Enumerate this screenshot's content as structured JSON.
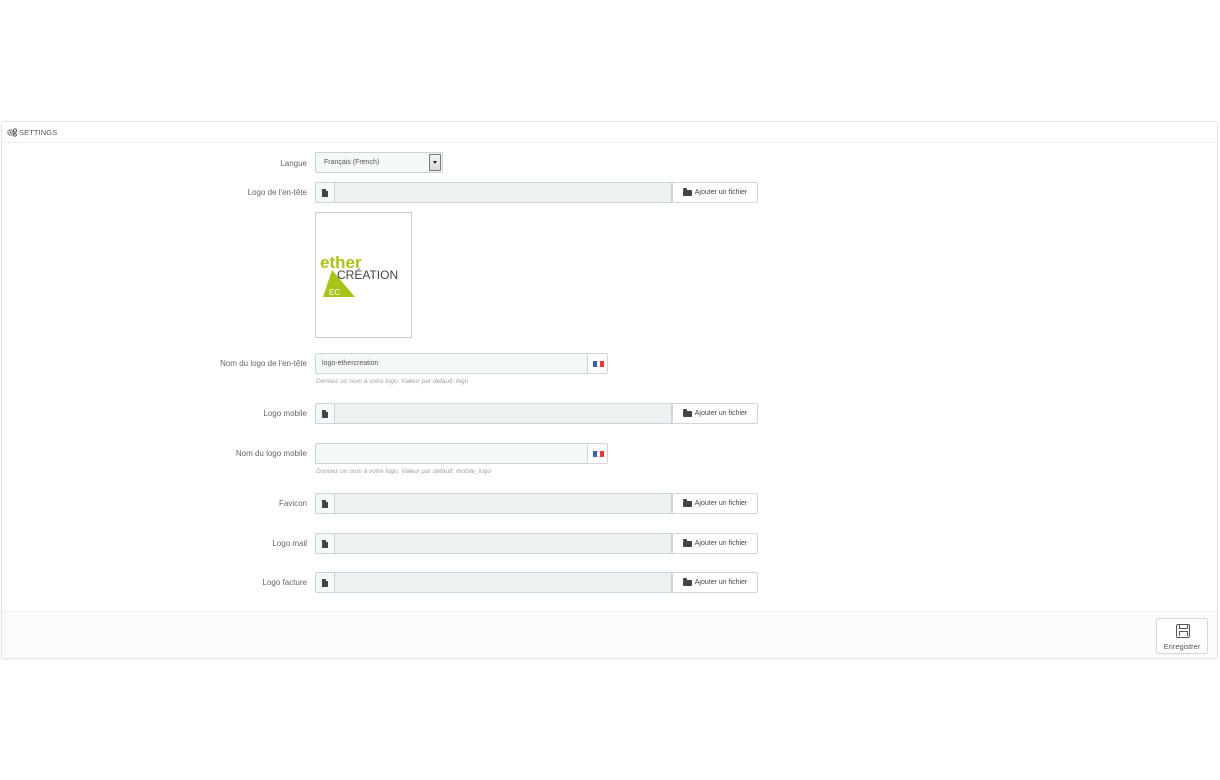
{
  "panel": {
    "heading": "SETTINGS",
    "heading_icon": "cogs-icon"
  },
  "form": {
    "langue": {
      "label": "Langue",
      "value": "Français (French)"
    },
    "header_logo": {
      "label": "Logo de l'en-tête",
      "button": "Ajouter un fichier"
    },
    "header_logo_preview": {
      "brand_primary": "ether",
      "brand_secondary": "CRÉATION",
      "brand_initials": "EC",
      "brand_color": "#a8c418"
    },
    "header_logo_name": {
      "label": "Nom du logo de l'en-tête",
      "value": "logo-ethercreation",
      "help": "Donnez un nom à votre logo. Valeur par default: logo"
    },
    "mobile_logo": {
      "label": "Logo mobile",
      "button": "Ajouter un fichier"
    },
    "mobile_logo_name": {
      "label": "Nom du logo mobile",
      "value": "",
      "help": "Donnez un nom à votre logo. Valeur par default: mobile_logo"
    },
    "favicon": {
      "label": "Favicon",
      "button": "Ajouter un fichier"
    },
    "mail_logo": {
      "label": "Logo mail",
      "button": "Ajouter un fichier"
    },
    "invoice_logo": {
      "label": "Logo facture",
      "button": "Ajouter un fichier"
    }
  },
  "footer": {
    "save_label": "Enregistrer",
    "save_icon": "floppy-icon"
  },
  "colors": {
    "flag_blue": "#3b5fb0",
    "flag_white": "#ffffff",
    "flag_red": "#e03b3b"
  }
}
